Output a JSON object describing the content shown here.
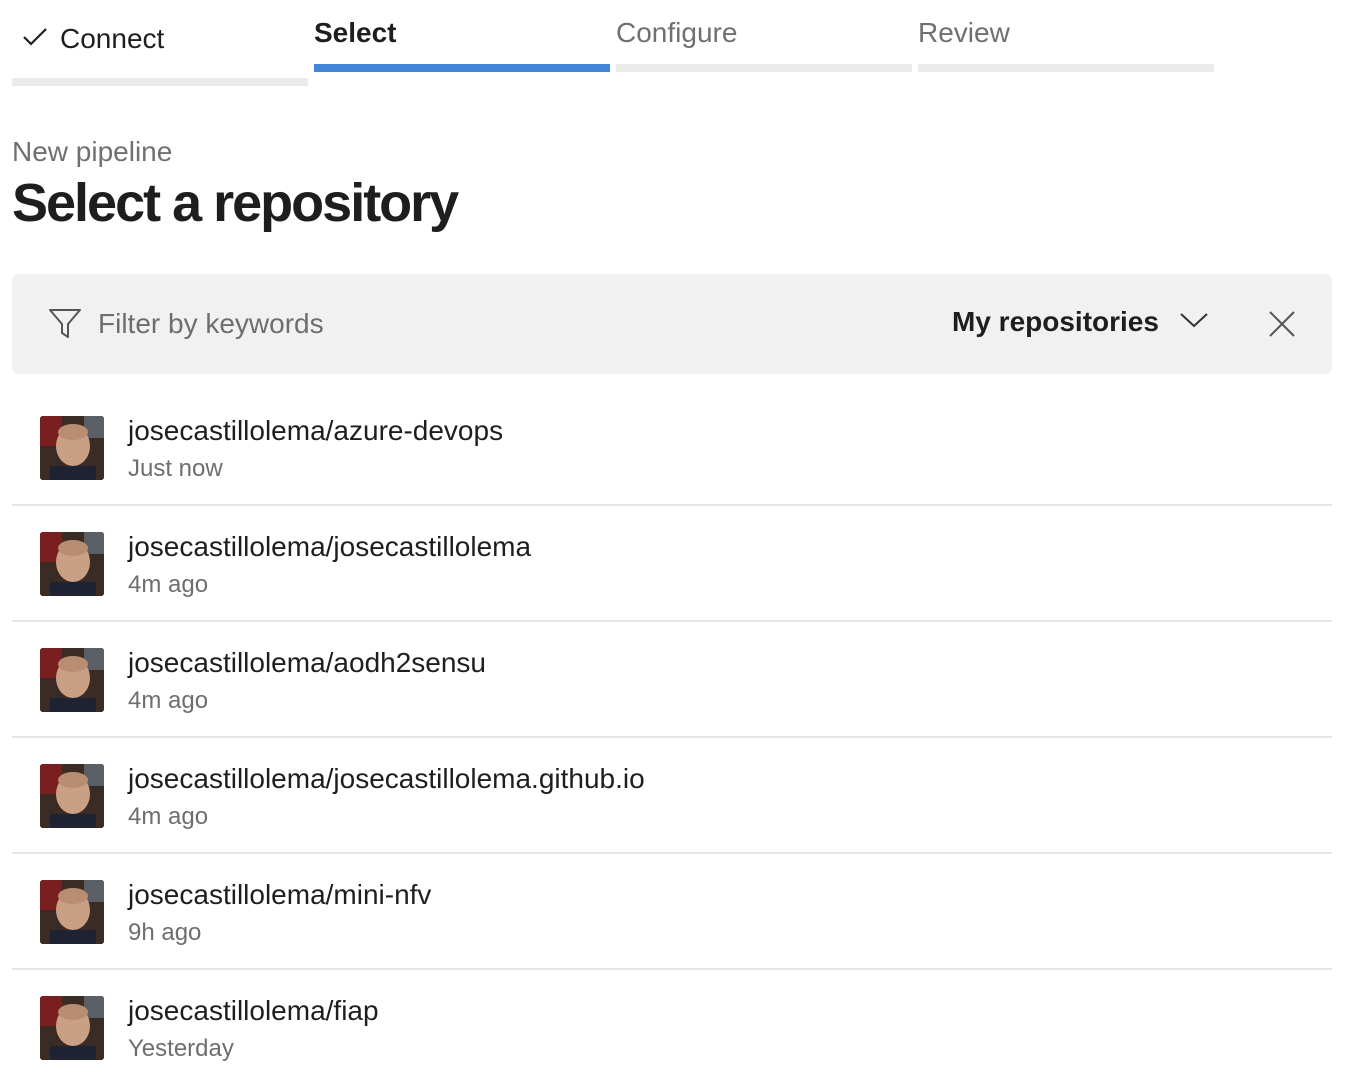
{
  "stepper": {
    "steps": [
      {
        "label": "Connect",
        "state": "completed"
      },
      {
        "label": "Select",
        "state": "active"
      },
      {
        "label": "Configure",
        "state": "pending"
      },
      {
        "label": "Review",
        "state": "pending"
      }
    ]
  },
  "header": {
    "subtitle": "New pipeline",
    "title": "Select a repository"
  },
  "filter": {
    "icon": "filter-icon",
    "placeholder": "Filter by keywords",
    "value": "",
    "dropdown_selected": "My repositories",
    "clear_icon": "close-icon"
  },
  "repositories": [
    {
      "name": "josecastillolema/azure-devops",
      "updated": "Just now"
    },
    {
      "name": "josecastillolema/josecastillolema",
      "updated": "4m ago"
    },
    {
      "name": "josecastillolema/aodh2sensu",
      "updated": "4m ago"
    },
    {
      "name": "josecastillolema/josecastillolema.github.io",
      "updated": "4m ago"
    },
    {
      "name": "josecastillolema/mini-nfv",
      "updated": "9h ago"
    },
    {
      "name": "josecastillolema/fiap",
      "updated": "Yesterday"
    }
  ],
  "colors": {
    "accent": "#3f86d6",
    "step_track": "#ebebeb",
    "filter_bg": "#f1f1f1",
    "secondary_text": "#707070"
  }
}
